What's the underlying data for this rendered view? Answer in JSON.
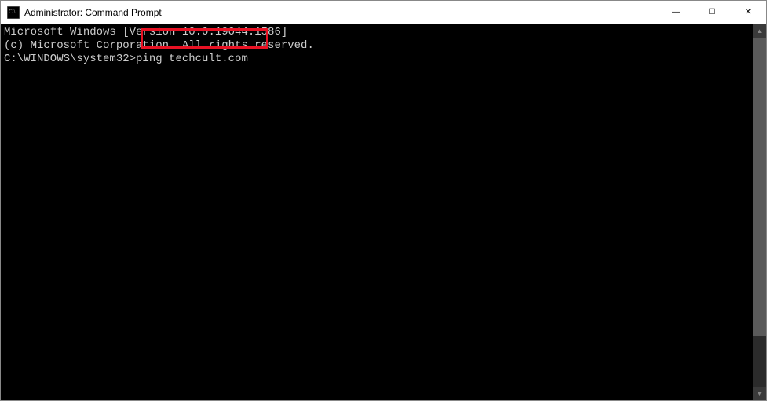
{
  "titlebar": {
    "title": "Administrator: Command Prompt"
  },
  "controls": {
    "minimize_glyph": "—",
    "maximize_glyph": "☐",
    "close_glyph": "✕"
  },
  "scrollbar": {
    "up_glyph": "▲",
    "down_glyph": "▼"
  },
  "console": {
    "line1": "Microsoft Windows [Version 10.0.19044.1586]",
    "line2": "(c) Microsoft Corporation. All rights reserved.",
    "blank": "",
    "prompt": "C:\\WINDOWS\\system32>",
    "command": "ping techcult.com"
  },
  "highlight": {
    "color": "#e81123"
  }
}
